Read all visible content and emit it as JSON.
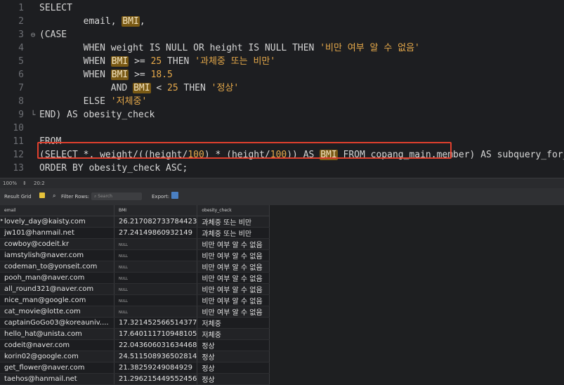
{
  "editor": {
    "lines": [
      {
        "no": "1",
        "fold": "",
        "html": "<span class='kw'>SELECT</span>"
      },
      {
        "no": "2",
        "fold": "",
        "html": "        email, <span class='hl'>BMI</span>,"
      },
      {
        "no": "3",
        "fold": "⊖",
        "html": "(<span class='kw'>CASE</span>"
      },
      {
        "no": "4",
        "fold": "",
        "html": "        <span class='kw'>WHEN</span> weight <span class='kw'>IS NULL OR</span> height <span class='kw'>IS NULL THEN</span> <span class='str'>'비만 여부 알 수 없음'</span>"
      },
      {
        "no": "5",
        "fold": "",
        "html": "        <span class='kw'>WHEN</span> <span class='hl'>BMI</span> >= <span class='num'>25</span> <span class='kw'>THEN</span> <span class='str'>'과체중 또는 비만'</span>"
      },
      {
        "no": "6",
        "fold": "",
        "html": "        <span class='kw'>WHEN</span> <span class='hl'>BMI</span> >= <span class='num'>18.5</span>"
      },
      {
        "no": "7",
        "fold": "",
        "html": "             <span class='kw'>AND</span> <span class='hl'>BMI</span> < <span class='num'>25</span> <span class='kw'>THEN</span> <span class='str'>'정상'</span>"
      },
      {
        "no": "8",
        "fold": "",
        "html": "        <span class='kw'>ELSE</span> <span class='str'>'저체중'</span>"
      },
      {
        "no": "9",
        "fold": "└",
        "html": "<span class='kw'>END</span>) <span class='kw'>AS</span> obesity_check"
      },
      {
        "no": "10",
        "fold": "",
        "html": ""
      },
      {
        "no": "11",
        "fold": "",
        "html": "<span class='kw'>FROM</span>"
      },
      {
        "no": "12",
        "fold": "",
        "html": "(<span class='kw'>SELECT</span> *, weight/((height/<span class='num'>100</span>) * (height/<span class='num'>100</span>)) <span class='kw'>AS</span> <span class='hl'>BMI</span> <span class='kw'>FROM</span> copang_main.member) <span class='kw'>AS</span> subquery_for_BMI"
      },
      {
        "no": "13",
        "fold": "",
        "html": "<span class='kw'>ORDER BY</span> obesity_check <span class='kw'>ASC</span>;"
      }
    ]
  },
  "status": {
    "zoom": "100%",
    "position": "20:2"
  },
  "toolbar": {
    "result_grid": "Result Grid",
    "filter_rows": "Filter Rows:",
    "search_placeholder": "Search",
    "export": "Export:"
  },
  "grid": {
    "columns": [
      "email",
      "BMI",
      "obesity_check"
    ],
    "rows": [
      [
        "lovely_day@kaisty.com",
        "26.217082733784423",
        "과체중 또는 비만"
      ],
      [
        "jw101@hanmail.net",
        "27.24149860932149",
        "과체중 또는 비만"
      ],
      [
        "cowboy@codeit.kr",
        "NULL",
        "비만 여부 알 수 없음"
      ],
      [
        "iamstylish@naver.com",
        "NULL",
        "비만 여부 알 수 없음"
      ],
      [
        "codeman_to@yonseit.com",
        "NULL",
        "비만 여부 알 수 없음"
      ],
      [
        "pooh_man@naver.com",
        "NULL",
        "비만 여부 알 수 없음"
      ],
      [
        "all_round321@naver.com",
        "NULL",
        "비만 여부 알 수 없음"
      ],
      [
        "nice_man@google.com",
        "NULL",
        "비만 여부 알 수 없음"
      ],
      [
        "cat_movie@lotte.com",
        "NULL",
        "비만 여부 알 수 없음"
      ],
      [
        "captainGoGo03@koreauniv....",
        "17.321452566514377",
        "저체중"
      ],
      [
        "hello_hat@unista.com",
        "17.640111710948105",
        "저체중"
      ],
      [
        "codeit@naver.com",
        "22.043606031634468",
        "정상"
      ],
      [
        "korin02@google.com",
        "24.511508936502814",
        "정상"
      ],
      [
        "get_flower@naver.com",
        "21.38259249084929",
        "정상"
      ],
      [
        "taehos@hanmail.net",
        "21.296215449552456",
        "정상"
      ]
    ]
  }
}
